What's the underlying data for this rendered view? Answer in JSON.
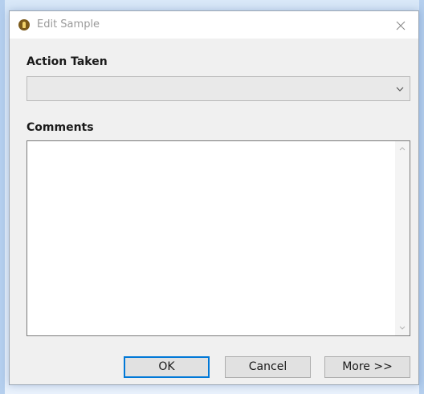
{
  "window": {
    "title": "Edit Sample",
    "close_glyph": "✕"
  },
  "form": {
    "action_label": "Action Taken",
    "action_value": "",
    "comments_label": "Comments",
    "comments_value": ""
  },
  "buttons": {
    "ok": "OK",
    "cancel": "Cancel",
    "more": "More >>"
  },
  "icons": {
    "app": "app-icon",
    "close": "close-icon",
    "dropdown": "chevron-down-icon",
    "scroll_up": "scroll-up-arrow-icon",
    "scroll_down": "scroll-down-arrow-icon"
  },
  "colors": {
    "default_button_border": "#0078d7",
    "dialog_background": "#f0f0f0",
    "title_text": "#9a9a9a"
  }
}
